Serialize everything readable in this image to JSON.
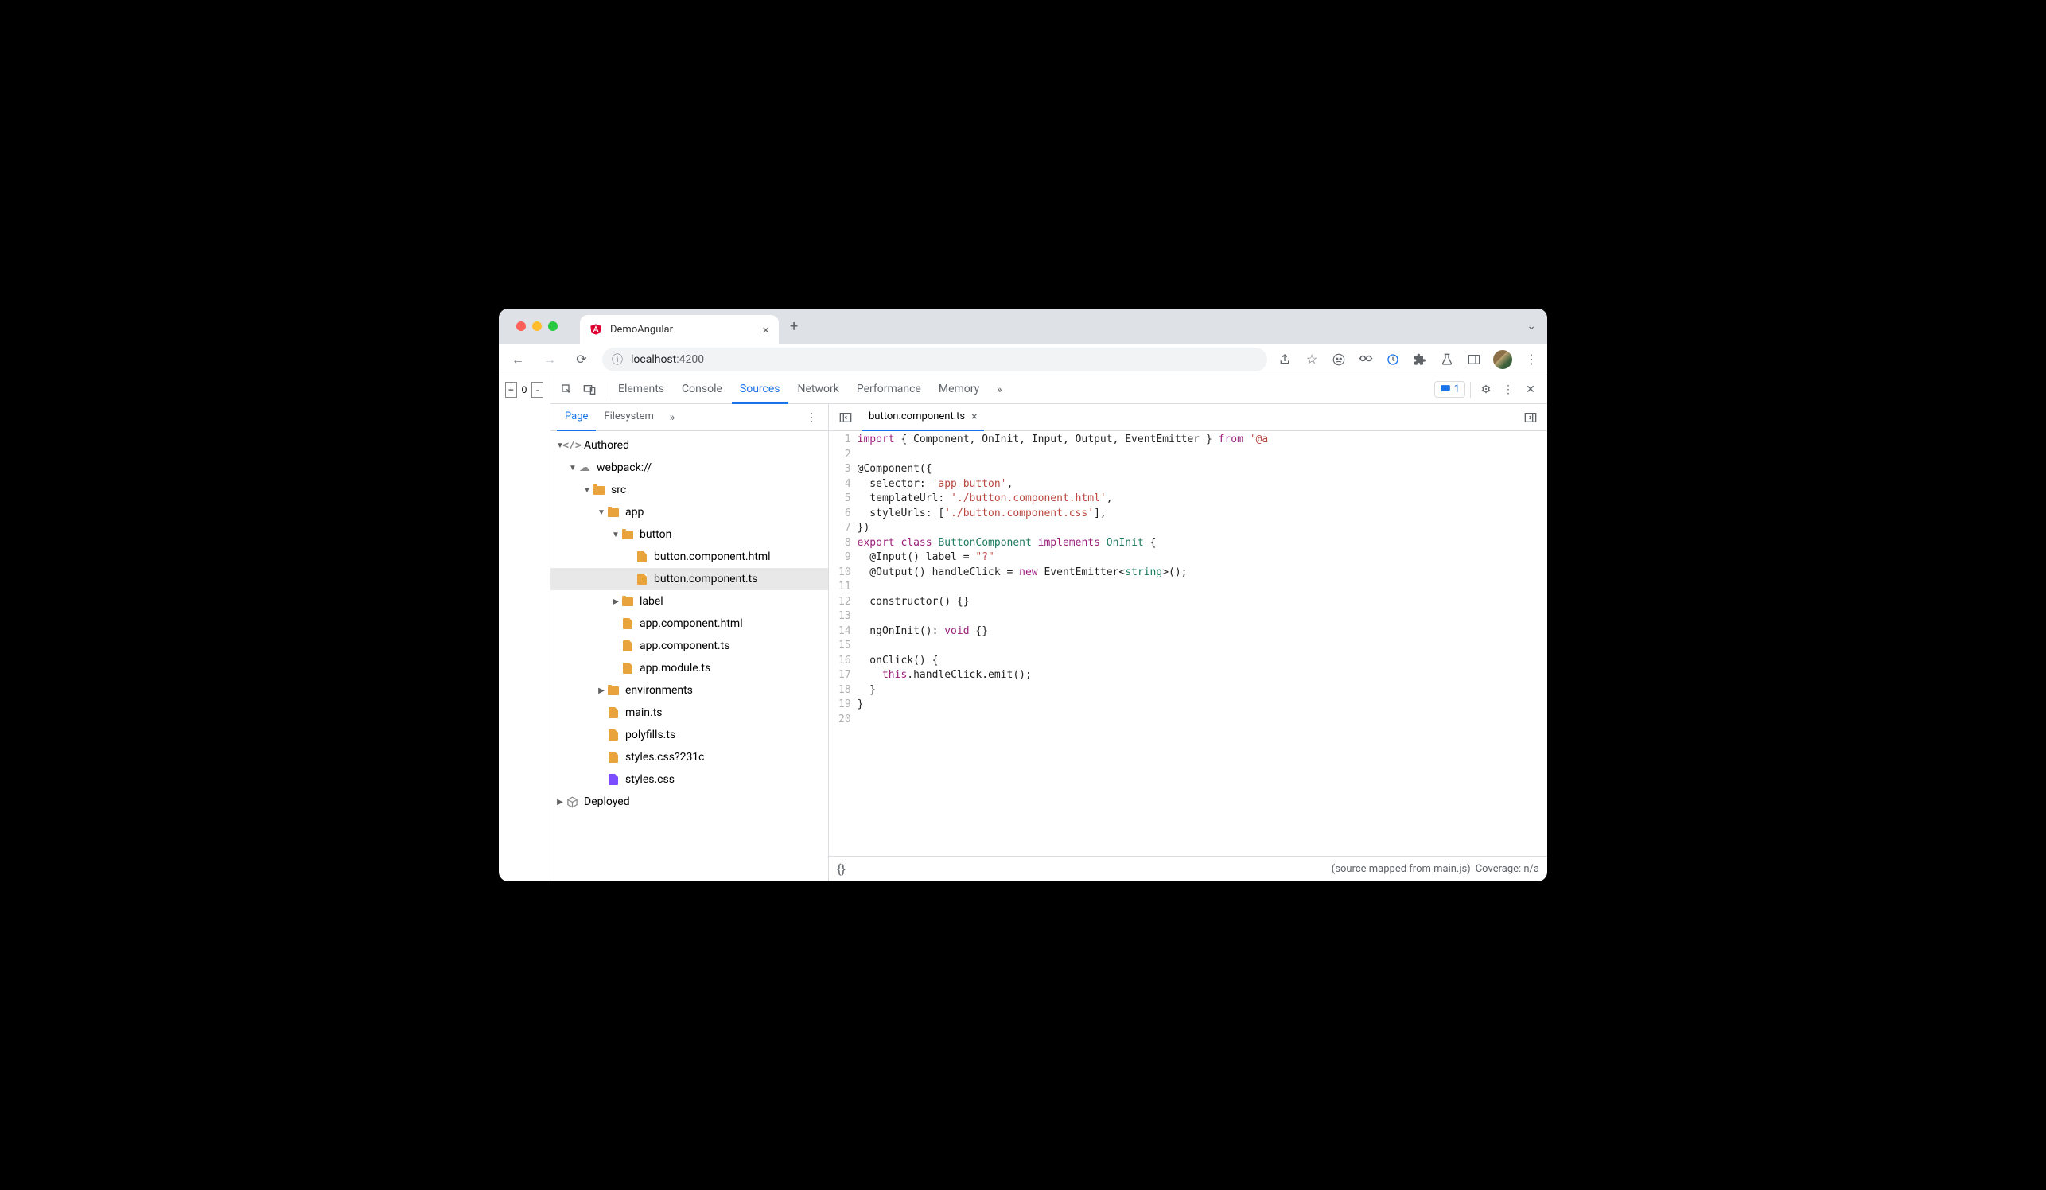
{
  "browser": {
    "tab_title": "DemoAngular",
    "url_host": "localhost",
    "url_port": ":4200"
  },
  "page_buttons": {
    "plus": "+",
    "zero": "0",
    "minus": "-"
  },
  "devtools": {
    "tabs": [
      "Elements",
      "Console",
      "Sources",
      "Network",
      "Performance",
      "Memory"
    ],
    "active_tab": "Sources",
    "issues_count": "1",
    "nav_tabs": [
      "Page",
      "Filesystem"
    ],
    "active_nav": "Page",
    "tree": {
      "authored": "Authored",
      "webpack": "webpack://",
      "src": "src",
      "app": "app",
      "button": "button",
      "button_html": "button.component.html",
      "button_ts": "button.component.ts",
      "label": "label",
      "app_html": "app.component.html",
      "app_ts": "app.component.ts",
      "app_module": "app.module.ts",
      "env": "environments",
      "main": "main.ts",
      "polyfills": "polyfills.ts",
      "styles_q": "styles.css?231c",
      "styles": "styles.css",
      "deployed": "Deployed"
    },
    "open_file": "button.component.ts",
    "code_lines": [
      {
        "n": 1,
        "segs": [
          {
            "t": "import",
            "c": "kw"
          },
          {
            "t": " { Component, OnInit, Input, Output, EventEmitter } "
          },
          {
            "t": "from",
            "c": "kw"
          },
          {
            "t": " "
          },
          {
            "t": "'@a",
            "c": "str"
          }
        ]
      },
      {
        "n": 2,
        "segs": []
      },
      {
        "n": 3,
        "segs": [
          {
            "t": "@Component({"
          }
        ]
      },
      {
        "n": 4,
        "segs": [
          {
            "t": "  selector: "
          },
          {
            "t": "'app-button'",
            "c": "str"
          },
          {
            "t": ","
          }
        ]
      },
      {
        "n": 5,
        "segs": [
          {
            "t": "  templateUrl: "
          },
          {
            "t": "'./button.component.html'",
            "c": "str"
          },
          {
            "t": ","
          }
        ]
      },
      {
        "n": 6,
        "segs": [
          {
            "t": "  styleUrls: ["
          },
          {
            "t": "'./button.component.css'",
            "c": "str"
          },
          {
            "t": "],"
          }
        ]
      },
      {
        "n": 7,
        "segs": [
          {
            "t": "})"
          }
        ]
      },
      {
        "n": 8,
        "segs": [
          {
            "t": "export",
            "c": "kw"
          },
          {
            "t": " "
          },
          {
            "t": "class",
            "c": "kw"
          },
          {
            "t": " "
          },
          {
            "t": "ButtonComponent",
            "c": "cls"
          },
          {
            "t": " "
          },
          {
            "t": "implements",
            "c": "kw"
          },
          {
            "t": " "
          },
          {
            "t": "OnInit",
            "c": "cls"
          },
          {
            "t": " {"
          }
        ]
      },
      {
        "n": 9,
        "segs": [
          {
            "t": "  @Input() label = "
          },
          {
            "t": "\"?\"",
            "c": "str"
          }
        ]
      },
      {
        "n": 10,
        "segs": [
          {
            "t": "  @Output() handleClick = "
          },
          {
            "t": "new",
            "c": "kw"
          },
          {
            "t": " EventEmitter<"
          },
          {
            "t": "string",
            "c": "typ"
          },
          {
            "t": ">();"
          }
        ]
      },
      {
        "n": 11,
        "segs": []
      },
      {
        "n": 12,
        "segs": [
          {
            "t": "  constructor() {}"
          }
        ]
      },
      {
        "n": 13,
        "segs": []
      },
      {
        "n": 14,
        "segs": [
          {
            "t": "  ngOnInit(): "
          },
          {
            "t": "void",
            "c": "kw"
          },
          {
            "t": " {}"
          }
        ]
      },
      {
        "n": 15,
        "segs": []
      },
      {
        "n": 16,
        "segs": [
          {
            "t": "  onClick() {"
          }
        ]
      },
      {
        "n": 17,
        "segs": [
          {
            "t": "    "
          },
          {
            "t": "this",
            "c": "kw"
          },
          {
            "t": ".handleClick.emit();"
          }
        ]
      },
      {
        "n": 18,
        "segs": [
          {
            "t": "  }"
          }
        ]
      },
      {
        "n": 19,
        "segs": [
          {
            "t": "}"
          }
        ]
      },
      {
        "n": 20,
        "segs": []
      }
    ],
    "status": {
      "mapped_prefix": "(source mapped from ",
      "mapped_link": "main.js",
      "mapped_suffix": ")",
      "coverage": "Coverage: n/a"
    }
  }
}
